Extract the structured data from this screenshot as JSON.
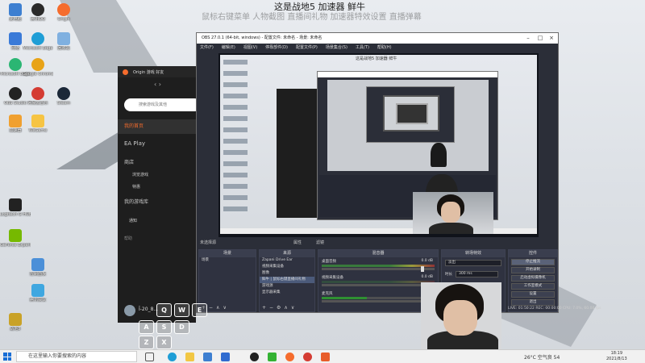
{
  "stream": {
    "title": "这是战地5 加速器 鲜牛",
    "subtitle": "鼠标右键菜单 人物截图 直播间礼物 加速器特效设置 直播弹幕"
  },
  "desktop_icons": [
    {
      "label": "此电脑",
      "color": "#3d7fd1"
    },
    {
      "label": "腾讯QQ",
      "color": "#2a2a2a"
    },
    {
      "label": "Origin",
      "color": "#f56c2d"
    },
    {
      "label": "网络",
      "color": "#3a7ad8"
    },
    {
      "label": "Microsoft Edge",
      "color": "#1f9ed6"
    },
    {
      "label": "回收站",
      "color": "#7fb0e0"
    },
    {
      "label": "Microsoft Edge",
      "color": "#2bb673"
    },
    {
      "label": "Google Chrome",
      "color": "#e8a317"
    },
    {
      "label": "OBS Studio",
      "color": "#222"
    },
    {
      "label": "网易云音乐",
      "color": "#d43c33"
    },
    {
      "label": "Steam",
      "color": "#1b2838"
    },
    {
      "label": "加速器",
      "color": "#f0a030"
    },
    {
      "label": "WeGame",
      "color": "#f6c443"
    },
    {
      "label": "Logitech G HUB",
      "color": "#222"
    },
    {
      "label": "GeForce Experience",
      "color": "#76b900"
    },
    {
      "label": "控制面板",
      "color": "#4b8fd8"
    },
    {
      "label": "腾讯会议",
      "color": "#3fa7e0"
    },
    {
      "label": "战地5",
      "color": "#c9a227"
    }
  ],
  "origin": {
    "nav": "Origin  游戏  好友",
    "back_forward": "‹  ›",
    "search_placeholder": "搜索游戏及其他",
    "menu": {
      "home": "我的首页",
      "ea_play": "EA Play",
      "store": "商店",
      "browse": "浏览游戏",
      "deals": "特惠",
      "library": "我的游戏库",
      "notifications": "通知",
      "help": "帮助"
    },
    "user": "Î-20_8..."
  },
  "obs": {
    "title": "OBS 27.0.1 (64-bit, windows) - 配置文件: 未命名 - 场景: 未命名",
    "menu": [
      "文件(F)",
      "编辑(E)",
      "视图(V)",
      "停靠部件(D)",
      "配置文件(P)",
      "场景集合(S)",
      "工具(T)",
      "帮助(H)"
    ],
    "nested_title": "这是战地5 加速器 鲜牛",
    "status_left": "未选择源",
    "properties": "属性",
    "filters": "滤镜",
    "docks": {
      "scenes": "场景",
      "sources": "来源",
      "mixer": "混音器",
      "transitions": "转场特效",
      "controls": "控件"
    },
    "scene_item": "场景",
    "sources": [
      "Zapani Drive Ear",
      "视频采集设备",
      "图像",
      "鲜牛 | 鼠标右键直播间礼物",
      "游戏源",
      "显示器采集"
    ],
    "mixer": [
      {
        "name": "桌面音频",
        "db": "0.0 dB"
      },
      {
        "name": "视频采集设备",
        "db": "0.0 dB"
      },
      {
        "name": "麦克风",
        "db": "0.0 dB"
      }
    ],
    "transition": {
      "type": "淡出",
      "duration_label": "时长",
      "duration": "300 ms"
    },
    "controls": [
      "停止推流",
      "开始录制",
      "启动虚拟摄像机",
      "工作室模式",
      "设置",
      "退出"
    ],
    "stats": "LIVE: 01:50:22   REC: 00:00:00   CPU: 7.0%, 60.00 fps"
  },
  "keyboard_overlay": [
    "Q",
    "W",
    "E",
    "A",
    "S",
    "D",
    "Z",
    "X"
  ],
  "taskbar": {
    "search_placeholder": "在这里输入你要搜索的内容",
    "tray_text": "26°C 空气良 54",
    "time": "18:19",
    "date": "2021/8/13"
  },
  "colors": {
    "obs_bg": "#2b2e38",
    "origin_accent": "#f56c2d",
    "windows_blue": "#1a6fd6"
  }
}
